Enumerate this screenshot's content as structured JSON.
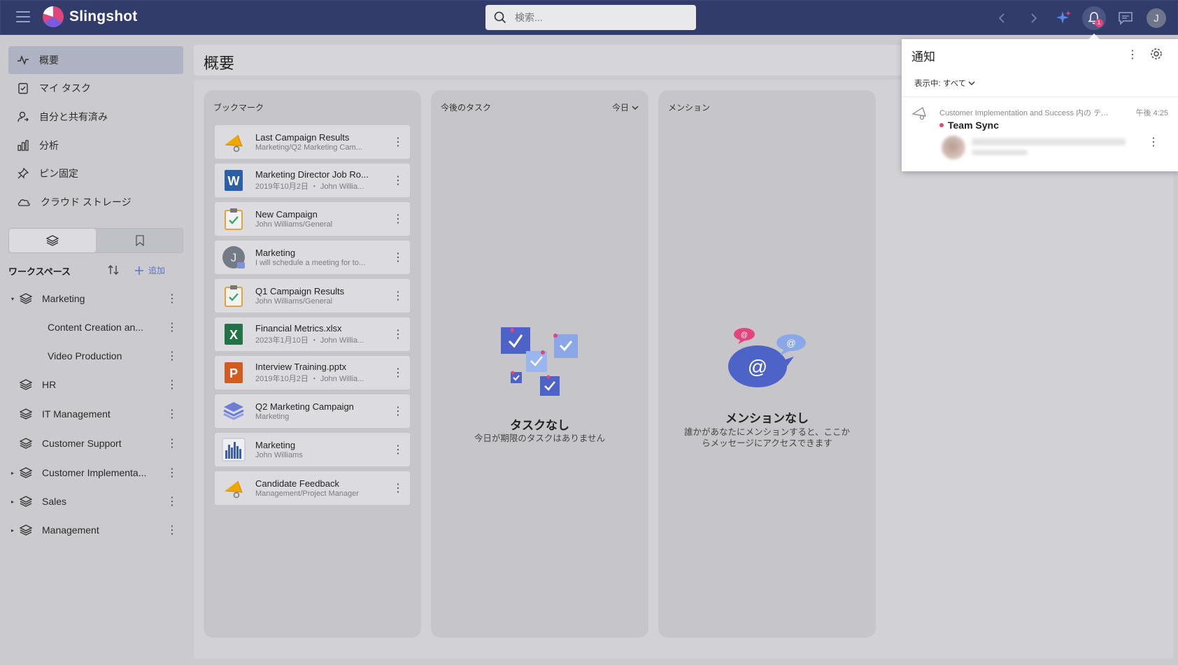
{
  "app": {
    "name": "Slingshot"
  },
  "search": {
    "placeholder": "検索..."
  },
  "notifications_badge": "1",
  "user_initial": "J",
  "sidebar": {
    "nav": [
      {
        "label": "概要",
        "icon": "activity-icon",
        "active": true
      },
      {
        "label": "マイ タスク",
        "icon": "task-clipboard-icon"
      },
      {
        "label": "自分と共有済み",
        "icon": "shared-user-icon"
      },
      {
        "label": "分析",
        "icon": "bar-chart-icon"
      },
      {
        "label": "ピン固定",
        "icon": "pin-icon"
      },
      {
        "label": "クラウド ストレージ",
        "icon": "cloud-icon"
      }
    ],
    "workspaces_title": "ワークスペース",
    "add_label": "追加",
    "workspaces": [
      {
        "label": "Marketing",
        "caret": "▾"
      },
      {
        "label": "Content Creation an...",
        "child": true
      },
      {
        "label": "Video Production",
        "child": true
      },
      {
        "label": "HR"
      },
      {
        "label": "IT Management"
      },
      {
        "label": "Customer Support"
      },
      {
        "label": "Customer Implementa...",
        "caret": "▸"
      },
      {
        "label": "Sales",
        "caret": "▸"
      },
      {
        "label": "Management",
        "caret": "▸"
      }
    ]
  },
  "main": {
    "title": "概要",
    "bookmarks": {
      "title": "ブックマーク",
      "items": [
        {
          "name": "Last Campaign Results",
          "sub": "Marketing/Q2 Marketing Cam...",
          "icon": "megaphone-icon"
        },
        {
          "name": "Marketing Director Job Ro...",
          "sub": "2019年10月2日 ・ John Willia...",
          "icon": "word-doc-icon"
        },
        {
          "name": "New Campaign",
          "sub": "John Williams/General",
          "icon": "task-clipboard-icon"
        },
        {
          "name": "Marketing",
          "sub": "I will schedule a meeting for to...",
          "icon": "user-chat-icon"
        },
        {
          "name": "Q1 Campaign Results",
          "sub": "John Williams/General",
          "icon": "task-clipboard-icon"
        },
        {
          "name": "Financial Metrics.xlsx",
          "sub": "2023年1月10日 ・ John Willia...",
          "icon": "excel-file-icon"
        },
        {
          "name": "Interview Training.pptx",
          "sub": "2019年10月2日 ・ John Willia...",
          "icon": "powerpoint-file-icon"
        },
        {
          "name": "Q2 Marketing Campaign",
          "sub": "Marketing",
          "icon": "workspace-layers-icon"
        },
        {
          "name": "Marketing",
          "sub": "John Williams",
          "icon": "dashboard-chart-icon"
        },
        {
          "name": "Candidate Feedback",
          "sub": "Management/Project Manager",
          "icon": "megaphone-icon"
        }
      ]
    },
    "tasks": {
      "title": "今後のタスク",
      "filter": "今日",
      "empty_title": "タスクなし",
      "empty_sub": "今日が期限のタスクはありません"
    },
    "mentions": {
      "title": "メンション",
      "empty_title": "メンションなし",
      "empty_sub_1": "誰かがあなたにメンションすると、ここか",
      "empty_sub_2": "らメッセージにアクセスできます"
    }
  },
  "notification_panel": {
    "title": "通知",
    "filter": "表示中: すべて",
    "item": {
      "from": "Customer Implementation and Success 内の ティ...",
      "time": "午後 4:25",
      "subject": "Team Sync"
    }
  },
  "colors": {
    "topbar": "#313c6a",
    "accent": "#5a73c8",
    "badge": "#e0457b"
  }
}
